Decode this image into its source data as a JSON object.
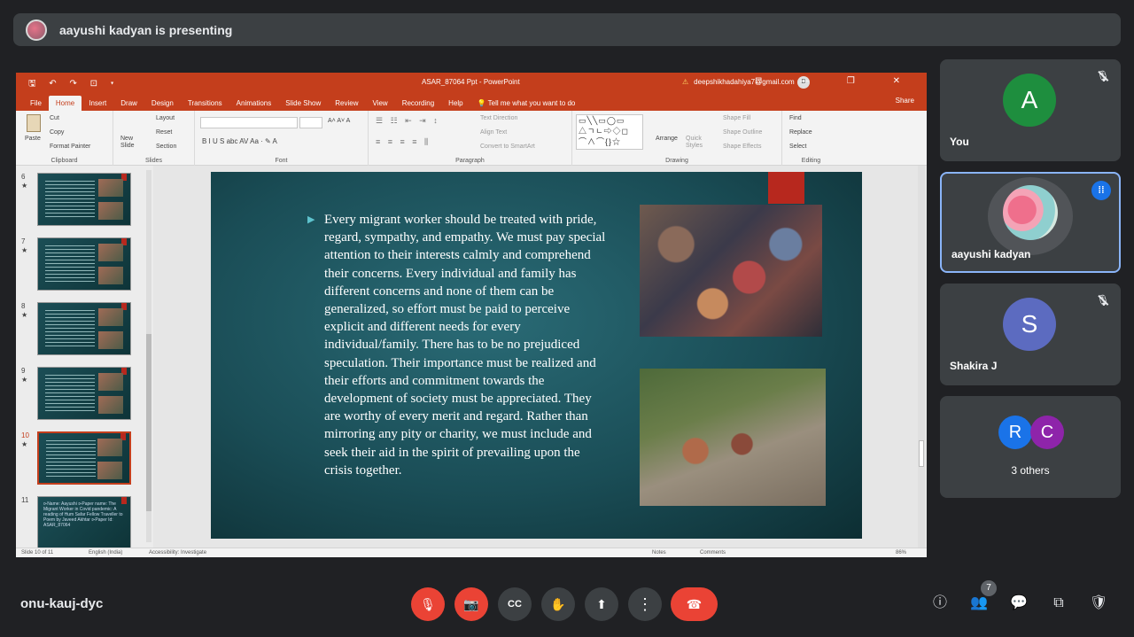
{
  "banner": {
    "text": "aayushi kadyan is presenting"
  },
  "ppt": {
    "quick_access": "🖫 ↶ ↷ ⊡ ▾",
    "filename": "ASAR_87064 Ppt - PowerPoint",
    "account": "deepshikhadahiya7@gmail.com",
    "account_initials": "D",
    "window_controls": "⊡ — ❐ ✕",
    "tabs": [
      "File",
      "Home",
      "Insert",
      "Draw",
      "Design",
      "Transitions",
      "Animations",
      "Slide Show",
      "Review",
      "View",
      "Recording",
      "Help",
      "💡 Tell me what you want to do"
    ],
    "share": "Share",
    "ribbon": {
      "clipboard": {
        "paste": "Paste",
        "cut": "Cut",
        "copy": "Copy",
        "format_painter": "Format Painter",
        "label": "Clipboard"
      },
      "slides": {
        "new_slide": "New Slide",
        "layout": "Layout",
        "reset": "Reset",
        "section": "Section",
        "label": "Slides"
      },
      "font": {
        "buttons": "B  I  U  S  abc  AV  Aa  ·  ✎  A",
        "grow": "A˄ A˅ A",
        "label": "Font"
      },
      "paragraph": {
        "text_direction": "Text Direction",
        "align_text": "Align Text",
        "convert": "Convert to SmartArt",
        "label": "Paragraph"
      },
      "drawing": {
        "arrange": "Arrange",
        "quick_styles": "Quick Styles",
        "shape_fill": "Shape Fill",
        "shape_outline": "Shape Outline",
        "shape_effects": "Shape Effects",
        "label": "Drawing"
      },
      "editing": {
        "find": "Find",
        "replace": "Replace",
        "select": "Select",
        "label": "Editing"
      }
    },
    "thumbnails": [
      {
        "num": "6",
        "star": "★"
      },
      {
        "num": "7",
        "star": "★"
      },
      {
        "num": "8",
        "star": "★"
      },
      {
        "num": "9",
        "star": "★"
      },
      {
        "num": "10",
        "star": "★"
      },
      {
        "num": "11",
        "star": ""
      }
    ],
    "thumb11_text": "⊳Name: Aayushi ⊳Paper name: The Migrant Worker in Covid pandemic: A reading of Hum Safar Fellow Traveller to Poem by Javeed Akhtar ⊳Paper Id: ASAR_87064",
    "slide_text": "Every migrant worker should be treated with pride, regard, sympathy, and empathy. We must pay special attention to their interests calmly and comprehend their concerns. Every individual and family has different concerns and none of them can be generalized, so effort must be paid to perceive explicit and different needs for every individual/family. There has to be no prejudiced speculation. Their importance must be realized and their efforts and commitment towards the development of society must be appreciated. They are worthy of every merit and regard. Rather than mirroring any pity or charity, we must include and seek their aid in the spirit of prevailing upon the crisis together.",
    "status": {
      "slide": "Slide 10 of 11",
      "language": "English (India)",
      "accessibility": "Accessibility: Investigate",
      "notes": "Notes",
      "comments": "Comments",
      "zoom": "86%"
    }
  },
  "participants": [
    {
      "name": "You",
      "initial": "A",
      "color": "#1e8e3e"
    },
    {
      "name": "aayushi kadyan"
    },
    {
      "name": "Shakira J",
      "initial": "S",
      "color": "#5c6bc0"
    },
    {
      "name": "3 others",
      "initials": [
        "R",
        "C"
      ],
      "colors": [
        "#1a73e8",
        "#8e24aa"
      ]
    }
  ],
  "meeting_code": "onu-kauj-dyc",
  "people_count": "7",
  "controls": {
    "mic": "🎙",
    "cam": "📷",
    "cc": "CC",
    "hand": "✋",
    "present": "⬆",
    "more": "⋮",
    "end": "☎"
  },
  "right_icons": {
    "info": "ⓘ",
    "people": "👥",
    "chat": "💬",
    "activities": "⧉",
    "host": "🛡"
  }
}
